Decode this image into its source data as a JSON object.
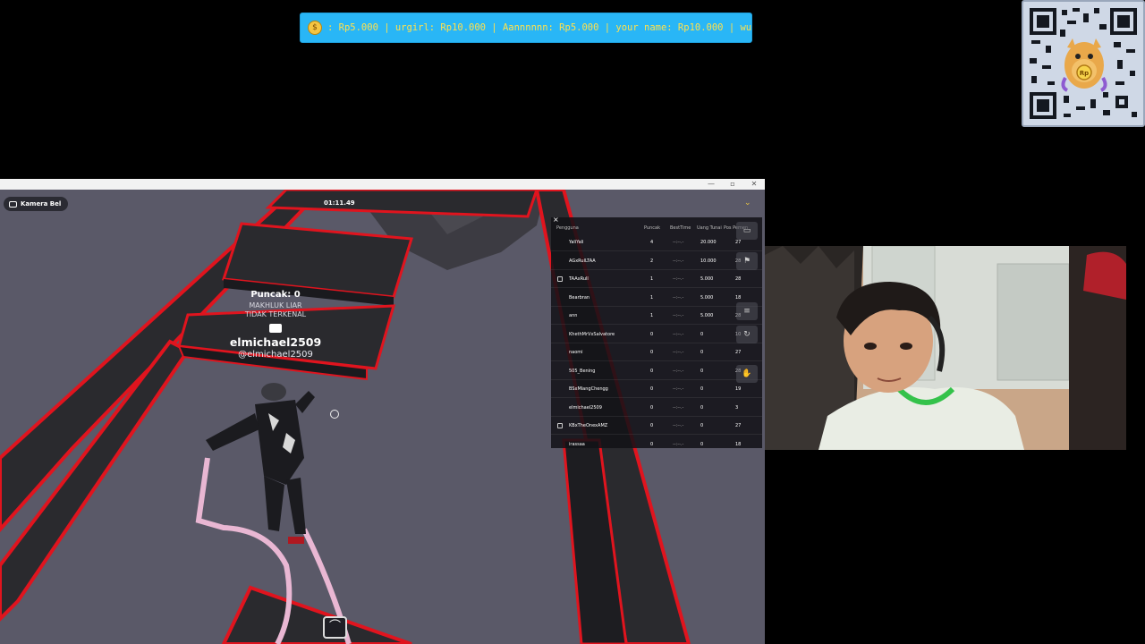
{
  "ticker": {
    "icon": "coin-mascot-icon",
    "text": ": Rp5.000 | urgirl: Rp10.000 | Aannnnnn: Rp5.000 | your name: Rp10.000 | wu"
  },
  "qr": {
    "icon": "qr-code-icon",
    "badge": "Rp"
  },
  "game": {
    "window_controls": [
      "—",
      "▫",
      "✕"
    ],
    "camera_button": "Kamera Bel",
    "timer": "01:11.49",
    "player": {
      "peak_label": "Puncak: 0",
      "title_line1": "MAKHLUK LIAR",
      "title_line2": "TIDAK TERKENAL",
      "name": "elmichael2509",
      "handle": "@elmichael2509"
    },
    "jump_icon": "jump-icon"
  },
  "leaderboard": {
    "close": "×",
    "headers": {
      "user": "Pengguna",
      "peak": "Puncak",
      "best": "BestTime",
      "money": "Uang Tunai",
      "pos": "Pos Pemen"
    },
    "rows": [
      {
        "user": "YaliYali",
        "peak": "4",
        "best": "--:--.-",
        "money": "20.000",
        "pos": "27",
        "icon": false
      },
      {
        "user": "AGxRulLTAA",
        "peak": "2",
        "best": "--:--.-",
        "money": "10.000",
        "pos": "28",
        "icon": false
      },
      {
        "user": "TAAxRull",
        "peak": "1",
        "best": "--:--.-",
        "money": "5.000",
        "pos": "28",
        "icon": true
      },
      {
        "user": "Bearbran",
        "peak": "1",
        "best": "--:--.-",
        "money": "5.000",
        "pos": "18",
        "icon": false
      },
      {
        "user": "ann",
        "peak": "1",
        "best": "--:--.-",
        "money": "5.000",
        "pos": "28",
        "icon": false
      },
      {
        "user": "KhethMrVxSalvatore",
        "peak": "0",
        "best": "--:--.-",
        "money": "0",
        "pos": "10",
        "icon": false
      },
      {
        "user": "naomi",
        "peak": "0",
        "best": "--:--.-",
        "money": "0",
        "pos": "27",
        "icon": false
      },
      {
        "user": "505_Bening",
        "peak": "0",
        "best": "--:--.-",
        "money": "0",
        "pos": "28",
        "icon": false
      },
      {
        "user": "BSxMlangChengg",
        "peak": "0",
        "best": "--:--.-",
        "money": "0",
        "pos": "19",
        "icon": false
      },
      {
        "user": "elmichael2509",
        "peak": "0",
        "best": "--:--.-",
        "money": "0",
        "pos": "3",
        "icon": false
      },
      {
        "user": "KBxTheOnexAMZ",
        "peak": "0",
        "best": "--:--.-",
        "money": "0",
        "pos": "27",
        "icon": true
      },
      {
        "user": "irassaa",
        "peak": "0",
        "best": "--:--.-",
        "money": "0",
        "pos": "18",
        "icon": false
      }
    ],
    "tools": [
      "chat-icon",
      "flag-icon",
      "list-icon",
      "refresh-icon",
      "hand-icon"
    ]
  },
  "webcam": {
    "icon": "webcam-feed"
  },
  "colors": {
    "ticker_bg": "#29b6f6",
    "ticker_text": "#ffe14d",
    "platform_edge": "#e0141e",
    "platform_top": "#2a2a2e",
    "ground": "#5a5968"
  }
}
